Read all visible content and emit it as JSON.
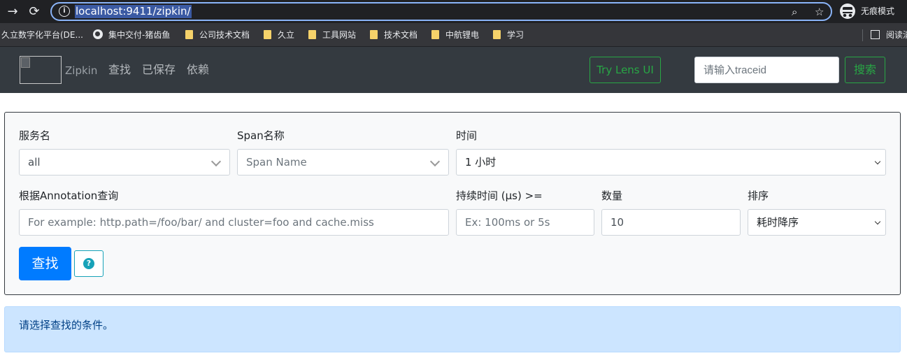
{
  "browser": {
    "url": "localhost:9411/zipkin/",
    "incognito_label": "无痕模式",
    "bookmarks": [
      {
        "label": "久立数字化平台(DE...",
        "icon": "none"
      },
      {
        "label": "集中交付-猪齿鱼",
        "icon": "globe-icon"
      },
      {
        "label": "公司技术文档",
        "icon": "folder-icon"
      },
      {
        "label": "久立",
        "icon": "folder-icon"
      },
      {
        "label": "工具网站",
        "icon": "folder-icon"
      },
      {
        "label": "技术文档",
        "icon": "folder-icon"
      },
      {
        "label": "中航锂电",
        "icon": "folder-icon"
      },
      {
        "label": "学习",
        "icon": "folder-icon"
      }
    ],
    "reading_list_label": "阅读清"
  },
  "nav": {
    "brand": "Zipkin",
    "links": [
      "查找",
      "已保存",
      "依赖"
    ],
    "lens_button": "Try Lens UI",
    "traceid_placeholder": "请输入traceid",
    "search_button": "搜索",
    "accent": "#28a745"
  },
  "search": {
    "service_label": "服务名",
    "service_value": "all",
    "span_label": "Span名称",
    "span_placeholder": "Span Name",
    "time_label": "时间",
    "time_value": "1 小时",
    "annotation_label": "根据Annotation查询",
    "annotation_placeholder": "For example: http.path=/foo/bar/ and cluster=foo and cache.miss",
    "duration_label": "持续时间 (μs) >=",
    "duration_placeholder": "Ex: 100ms or 5s",
    "limit_label": "数量",
    "limit_value": "10",
    "sort_label": "排序",
    "sort_value": "耗时降序",
    "find_button": "查找",
    "help_icon": "question-circle-icon"
  },
  "alert": {
    "message": "请选择查找的条件。"
  }
}
